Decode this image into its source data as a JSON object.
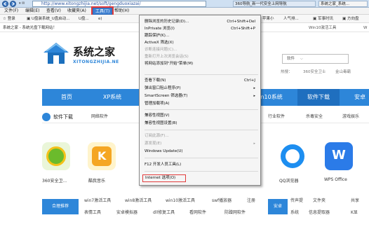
{
  "browser": {
    "url": "http://www.xitongzhijia.net/soft/gengduoxiazai/",
    "tabs": [
      "360导航_新一代安全上网导航",
      "系统之家_系统..."
    ]
  },
  "menubar": {
    "items": [
      "文件(F)",
      "编辑(E)",
      "查看(V)",
      "收藏夹(A)",
      "工具(T)",
      "帮助(H)"
    ]
  },
  "favorites": {
    "items": [
      "登录",
      "U盘装系统_U盘启动...",
      "U盘...",
      "e)",
      "看新发布-影视",
      "家居软件",
      "简",
      "美图...",
      "苹果手机...",
      "苹果小",
      "人气排...",
      "军事时讯",
      "方向盘"
    ]
  },
  "site": {
    "breadcrumb": "系统之家 - 系统光盘下载网站！",
    "right_crumb": "Win10激活工具",
    "right_crumb2": "W",
    "logo_title": "系统之家",
    "logo_sub": "XITONGZHIJIA.NE",
    "search_placeholder": "软件",
    "hot_links": [
      "热搜：",
      "360安全卫士",
      "金山毒霸"
    ],
    "nav": [
      "首页",
      "XP系统",
      "in10系统",
      "软件下载",
      "安卓"
    ],
    "category_title": "软件下载",
    "categories": [
      "网络软件",
      "行业软件",
      "杀毒安全",
      "游戏娱乐"
    ],
    "apps": [
      "360安全卫...",
      "酷我音乐",
      "QQ浏览器",
      "WPS Office"
    ],
    "hot_label": "合理推荐",
    "links_row1": [
      "win7激活工具",
      "win8激活工具",
      "win10激活工具",
      "swf播放器",
      "注册"
    ],
    "links_row2": [
      "表情工具",
      "安卓模拟器",
      "dll修复工具",
      "看网软件",
      "防蹭网软件"
    ],
    "links_row3_right": [
      "安卓",
      "传声提",
      "文件夹",
      "共享"
    ],
    "links_row4_right": [
      "系统",
      "信息提取器",
      "K显"
    ]
  },
  "tools_menu": {
    "items": [
      {
        "label": "删除浏览的历史记录(D)...",
        "shortcut": "Ctrl+Shift+Del",
        "disabled": false
      },
      {
        "label": "InPrivate 浏览(I)",
        "shortcut": "Ctrl+Shift+P",
        "disabled": false
      },
      {
        "label": "跟踪保护(K)...",
        "shortcut": "",
        "disabled": false
      },
      {
        "label": "ActiveX 筛选(X)",
        "shortcut": "",
        "disabled": false
      },
      {
        "label": "诊断连接问题(C)...",
        "shortcut": "",
        "disabled": true
      },
      {
        "label": "重新打开上次浏览会话(S)",
        "shortcut": "",
        "disabled": true
      },
      {
        "label": "将网站添加到\"开始\"菜单(M)",
        "shortcut": "",
        "disabled": false
      },
      {
        "label": "查看下载(N)",
        "shortcut": "Ctrl+J",
        "disabled": false
      },
      {
        "label": "弹出窗口阻止程序(P)",
        "shortcut": "",
        "disabled": false,
        "submenu": true
      },
      {
        "label": "SmartScreen 筛选器(T)",
        "shortcut": "",
        "disabled": false,
        "submenu": true
      },
      {
        "label": "管理加载项(A)",
        "shortcut": "",
        "disabled": false
      },
      {
        "label": "兼容性视图(V)",
        "shortcut": "",
        "disabled": false
      },
      {
        "label": "兼容性视图设置(B)",
        "shortcut": "",
        "disabled": false
      },
      {
        "label": "订阅此源(F)...",
        "shortcut": "",
        "disabled": true
      },
      {
        "label": "源发现(E)",
        "shortcut": "",
        "disabled": true,
        "submenu": true
      },
      {
        "label": "Windows Update(U)",
        "shortcut": "",
        "disabled": false
      },
      {
        "label": "F12 开发人员工具(L)",
        "shortcut": "",
        "disabled": false
      },
      {
        "label": "Internet 选项(O)",
        "shortcut": "",
        "disabled": false
      }
    ]
  },
  "colors": {
    "nav_blue": "#2d86d9",
    "highlight_red": "#e23b3b",
    "menu_selected": "#3c7fd1"
  }
}
